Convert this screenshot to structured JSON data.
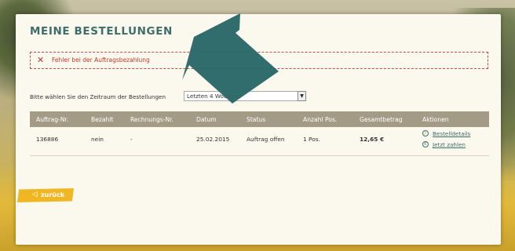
{
  "page": {
    "title": "MEINE BESTELLUNGEN"
  },
  "error": {
    "icon": "close-icon",
    "text": "Fehler bei der Auftragsbezahlung"
  },
  "filter": {
    "label": "Bitte wählen Sie den Zeitraum der Bestellungen",
    "selected": "Letzten 4 Wochen"
  },
  "table": {
    "headers": [
      "Auftrag-Nr.",
      "Bezahlt",
      "Rechnungs-Nr.",
      "Datum",
      "Status",
      "Anzahl Pos.",
      "Gesamtbetrag",
      "Aktionen"
    ],
    "rows": [
      {
        "order_no": "136886",
        "paid": "nein",
        "invoice_no": "-",
        "date": "25.02.2015",
        "status": "Auftrag offen",
        "positions": "1 Pos.",
        "total": "12,65 €",
        "actions": [
          "Bestelldetails",
          "Jetzt zahlen"
        ]
      }
    ]
  },
  "back_button": {
    "label": "zurück"
  },
  "colors": {
    "accent": "#3f6e6a",
    "error": "#c0392b",
    "header_bg": "#a49b86",
    "button": "#f1b722"
  }
}
